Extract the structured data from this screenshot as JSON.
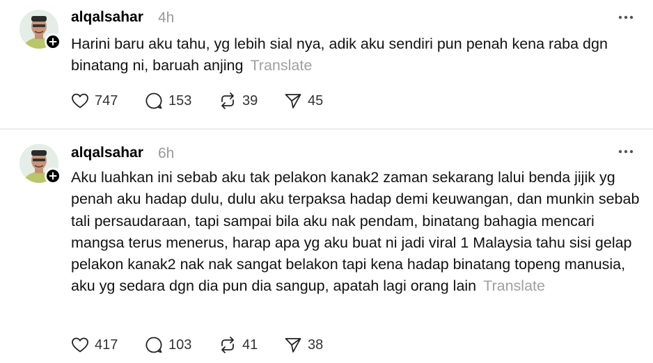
{
  "posts": [
    {
      "username": "alqalsahar",
      "time": "4h",
      "text": "Harini baru aku tahu, yg lebih sial nya, adik aku sendiri pun penah kena raba dgn binatang ni, baruah anjing",
      "translate": "Translate",
      "likes": "747",
      "replies": "153",
      "reposts": "39",
      "shares": "45"
    },
    {
      "username": "alqalsahar",
      "time": "6h",
      "text": "Aku luahkan ini sebab aku tak pelakon kanak2 zaman sekarang lalui benda jijik yg penah aku hadap dulu, dulu aku terpaksa hadap demi keuwangan, dan munkin sebab tali persaudaraan, tapi sampai bila aku nak pendam, binatang bahagia mencari mangsa terus menerus, harap apa yg aku buat ni jadi viral 1 Malaysia tahu sisi gelap pelakon kanak2 nak nak sangat belakon tapi kena hadap binatang topeng manusia, aku yg sedara dgn dia pun dia sangup, apatah lagi orang lain",
      "translate": "Translate",
      "likes": "417",
      "replies": "103",
      "reposts": "41",
      "shares": "38"
    }
  ],
  "icons": {
    "like": "heart-icon",
    "reply": "comment-icon",
    "repost": "repost-icon",
    "share": "send-icon",
    "more": "more-icon",
    "follow": "plus-icon"
  },
  "colors": {
    "text": "#111111",
    "muted": "#999999",
    "divider": "#dcdcdc",
    "badge": "#000000"
  }
}
